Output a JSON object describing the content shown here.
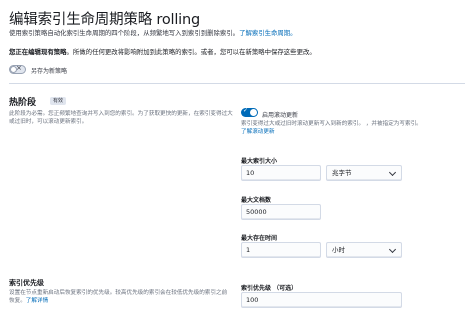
{
  "page": {
    "title": "编辑索引生命周期策略 rolling",
    "intro": "使用索引策略自动化索引生命周期的四个阶段，从频繁地写入到索引到删除索引。",
    "intro_link": "了解索引生命周期。",
    "warning_bold": "您正在编辑现有策略",
    "warning_rest": "。所做的任何更改将影响附加到此策略的索引。或者，您可以在新策略中保存这些更改。",
    "save_as_new_label": "另存为新策略"
  },
  "hot_phase": {
    "title": "热阶段",
    "badge": "有效",
    "description_1": "此阶段为必需。您正频繁地查询并写入到您的索引。为了获取更快的更新，在索引变得过大",
    "description_2": "或过旧时，可以滚动更新索引。",
    "rollover_toggle_label": "启用滚动更新",
    "rollover_help_1": "索引变得过大或过旧时滚动更新写入到新的索引。 ，并被指定为写索引。",
    "rollover_help_link": "了解滚动更新",
    "max_size_label": "最大索引大小",
    "max_size_value": "10",
    "max_size_unit": "兆字节",
    "max_docs_label": "最大文档数",
    "max_docs_value": "50000",
    "max_age_label": "最大存在时间",
    "max_age_value": "1",
    "max_age_unit": "小时"
  },
  "priority": {
    "title": "索引优先级",
    "description_1": "设置在节点重新启动后恢复索引的优先级。较高优先级的索引会在较低优先级的索引之前",
    "description_2": "恢复。",
    "description_link": "了解详情",
    "field_label": "索引优先级 （可选）",
    "value": "100"
  }
}
